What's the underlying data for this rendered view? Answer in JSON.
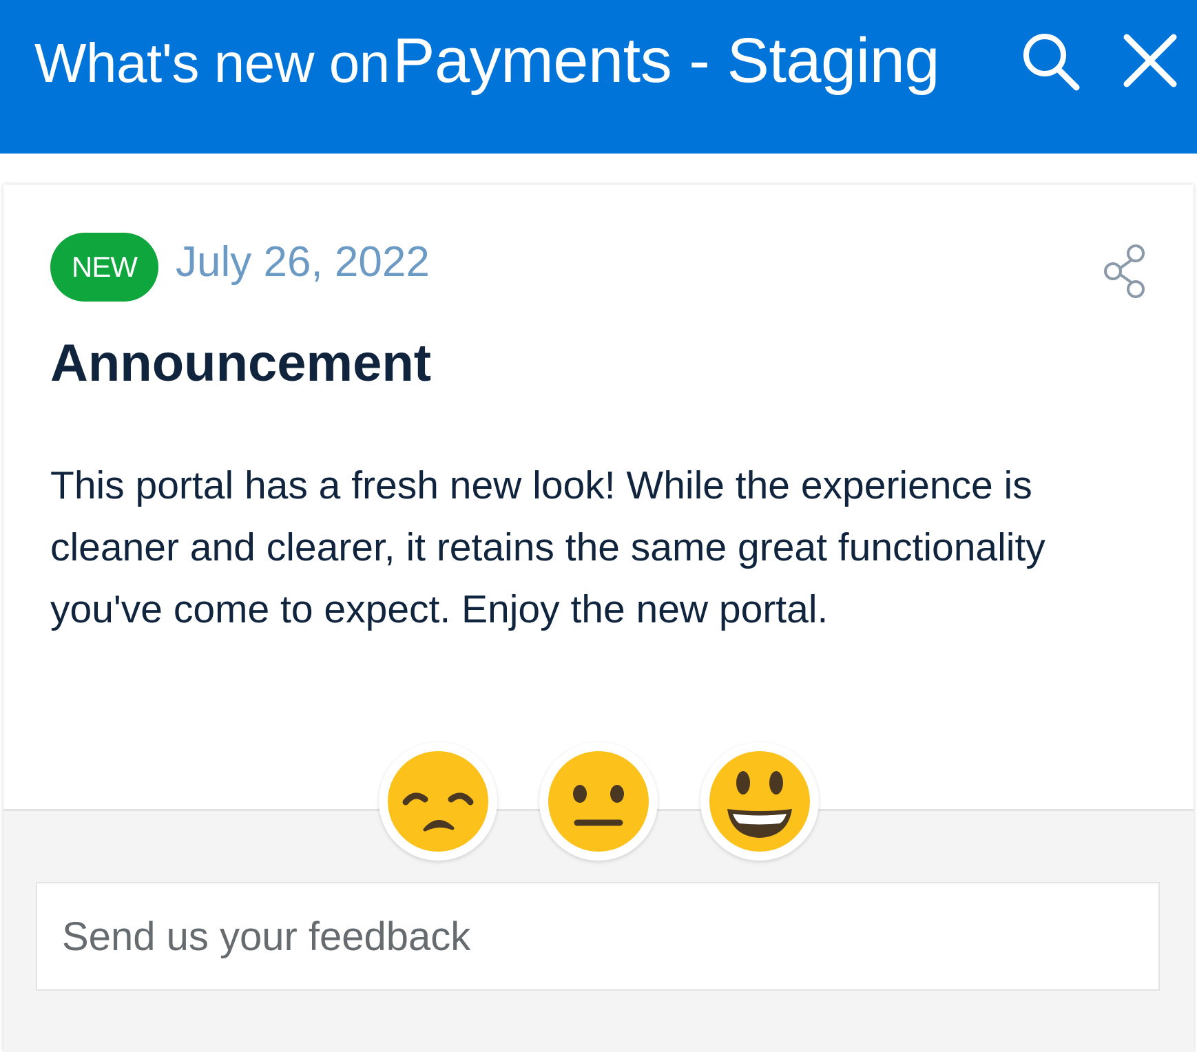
{
  "header": {
    "title_prefix": "What's new on",
    "app_name": "Payments - Staging",
    "search_icon": "search-icon",
    "close_icon": "close-icon",
    "background_color": "#0074d9"
  },
  "post": {
    "badge": "NEW",
    "badge_color": "#0ea63d",
    "date": "July 26, 2022",
    "share_icon": "share-icon",
    "title": "Announcement",
    "body": "This portal has a fresh new look! While the experience is cleaner and clearer, it retains the same great functionality you've come to expect. Enjoy the new portal."
  },
  "reactions": [
    {
      "name": "sad",
      "icon": "unamused-face-icon"
    },
    {
      "name": "neutral",
      "icon": "neutral-face-icon"
    },
    {
      "name": "happy",
      "icon": "smiling-face-icon"
    }
  ],
  "feedback": {
    "placeholder": "Send us your feedback",
    "value": ""
  }
}
